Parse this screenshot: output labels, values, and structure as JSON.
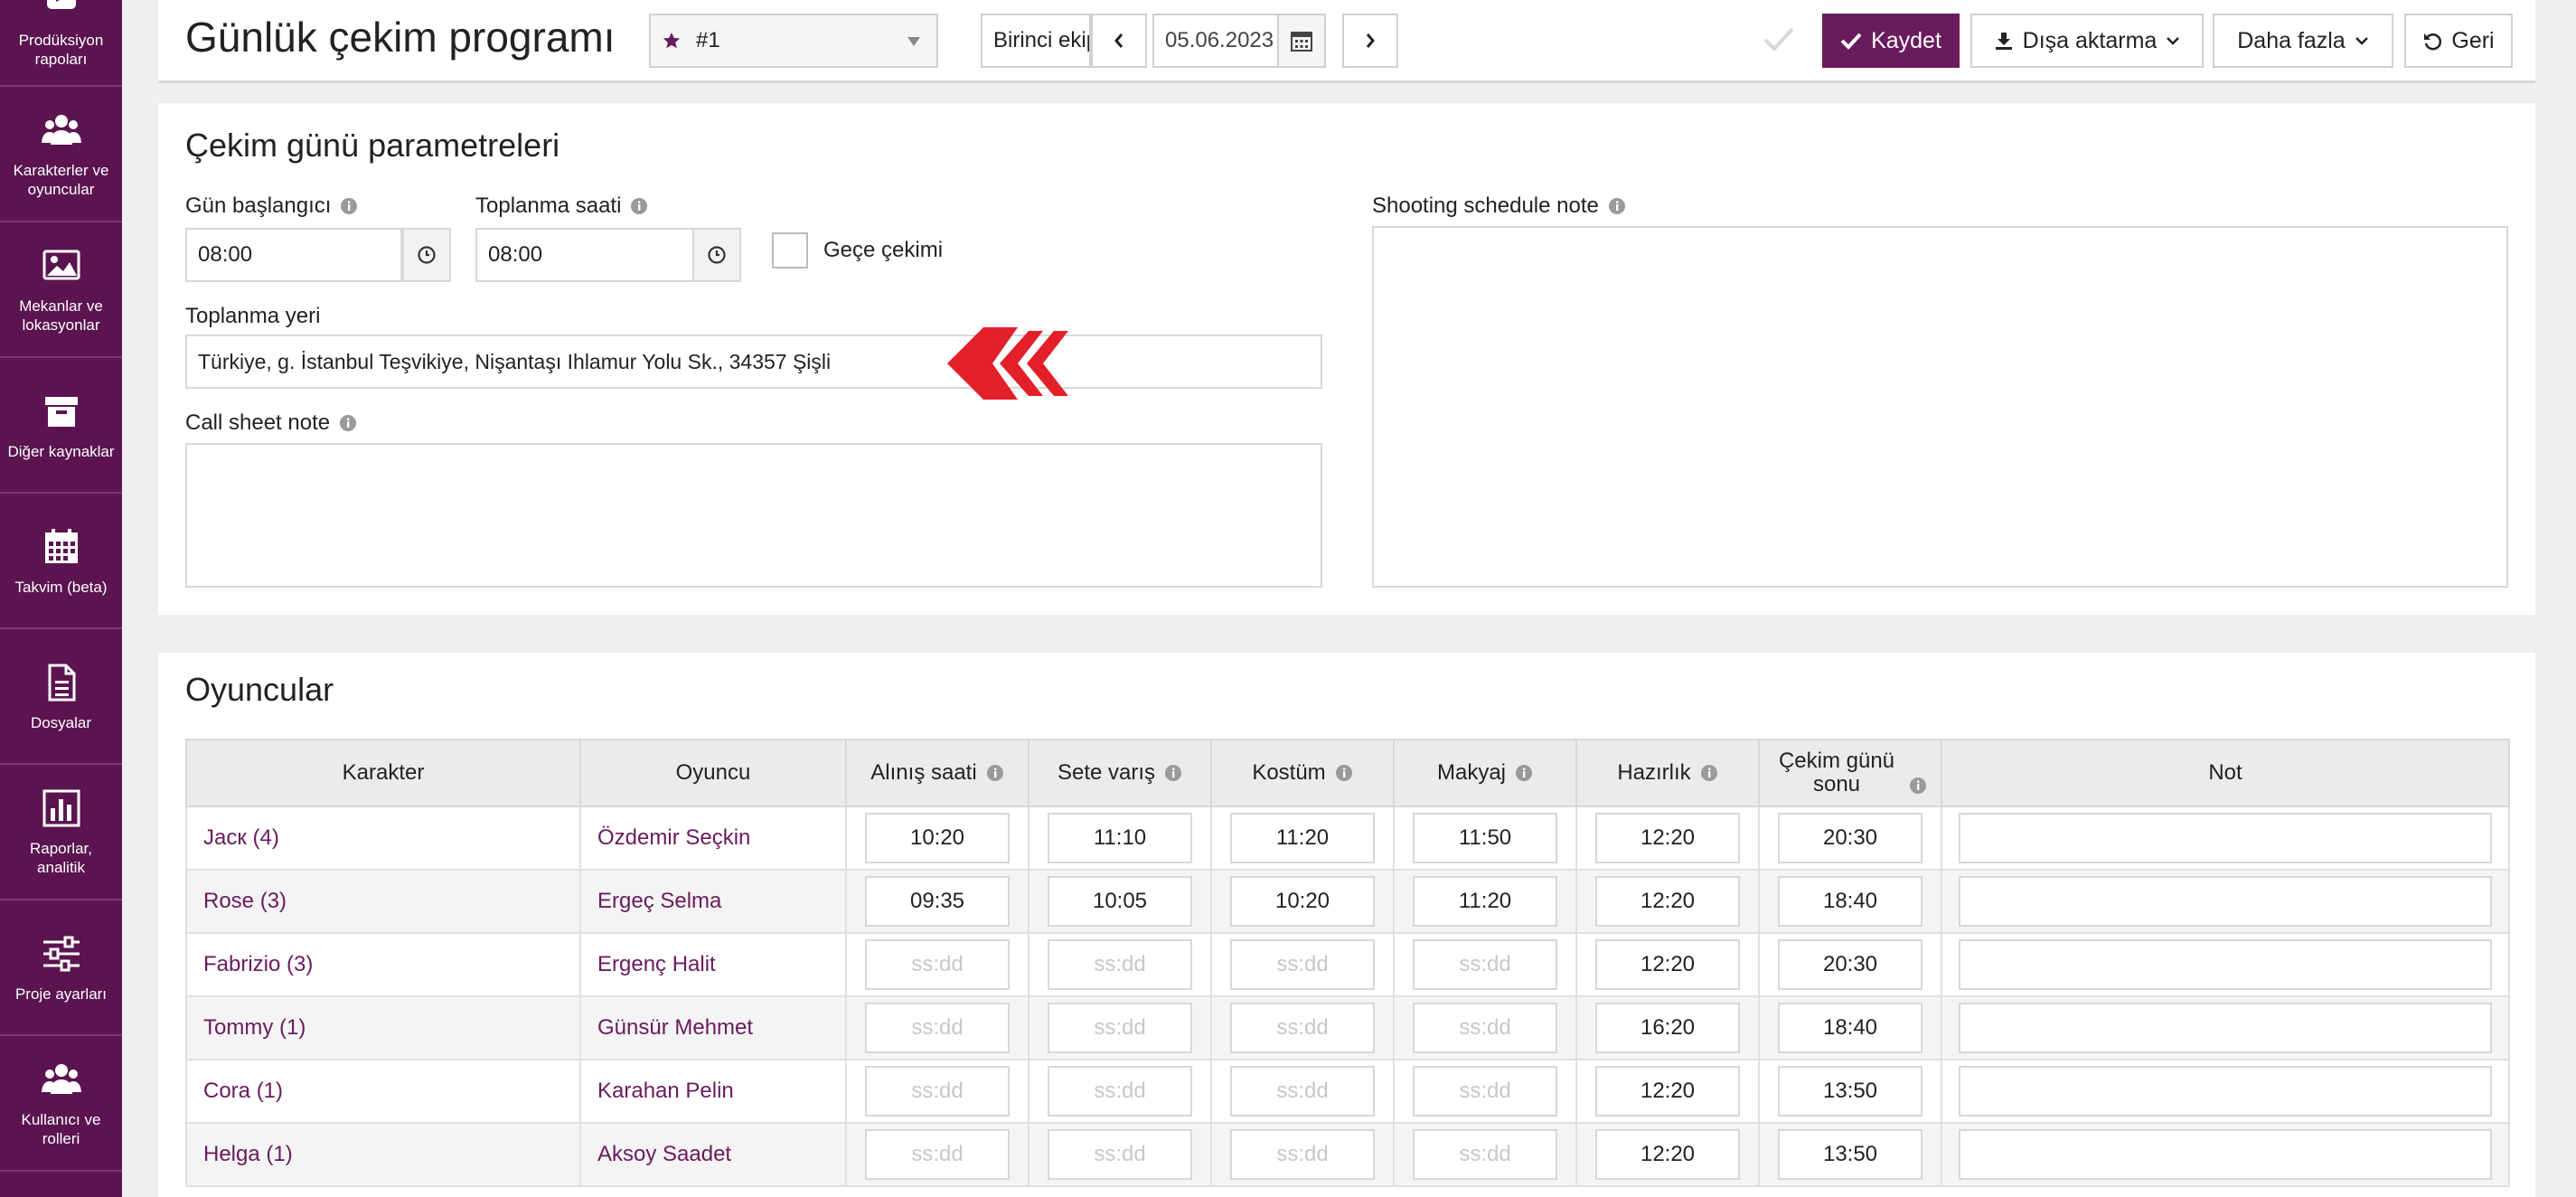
{
  "sidebar": {
    "items": [
      {
        "label": "Prodüksiyon rapoları",
        "icon": "report-icon"
      },
      {
        "label": "Karakterler ve oyuncular",
        "icon": "people-icon"
      },
      {
        "label": "Mekanlar ve lokasyonlar",
        "icon": "image-icon"
      },
      {
        "label": "Diğer kaynaklar",
        "icon": "archive-icon"
      },
      {
        "label": "Takvim (beta)",
        "icon": "calendar-icon"
      },
      {
        "label": "Dosyalar",
        "icon": "document-icon"
      },
      {
        "label": "Raporlar, analitik",
        "icon": "bar-chart-icon"
      },
      {
        "label": "Proje ayarları",
        "icon": "sliders-icon"
      },
      {
        "label": "Kullanıcı ve rolleri",
        "icon": "users-icon"
      }
    ],
    "bg_color": "#5b1450"
  },
  "header": {
    "title": "Günlük çekim programı",
    "schedule_select": "#1",
    "team_input": "Birinci ekip",
    "date": "05.06.2023",
    "save_label": "Kaydet",
    "export_label": "Dışa aktarma",
    "more_label": "Daha fazla",
    "back_label": "Geri",
    "accent_color": "#6a1b5e"
  },
  "params": {
    "title": "Çekim günü parametreleri",
    "day_start_label": "Gün başlangıcı",
    "day_start_value": "08:00",
    "gathering_time_label": "Toplanma saati",
    "gathering_time_value": "08:00",
    "night_shoot_label": "Geçe çekimi",
    "night_shoot_checked": false,
    "gathering_place_label": "Toplanma yeri",
    "gathering_place_value": "Türkiye, g. İstanbul Teşvikiye, Nişantaşı Ihlamur Yolu Sk., 34357 Şişli",
    "call_sheet_note_label": "Call sheet note",
    "shooting_note_label": "Shooting schedule note"
  },
  "cast": {
    "title": "Oyuncular",
    "columns": {
      "character": "Karakter",
      "actor": "Oyuncu",
      "pickup": "Alınış saati",
      "arrival": "Sete varış",
      "costume": "Kostüm",
      "makeup": "Makyaj",
      "ready": "Hazırlık",
      "wrap": "Çekim günü sonu",
      "note": "Not"
    },
    "placeholder": "ss:dd",
    "rows": [
      {
        "character": "Jacк (4)",
        "actor": "Özdemir Seçkin",
        "pickup": "10:20",
        "arrival": "11:10",
        "costume": "11:20",
        "makeup": "11:50",
        "ready": "12:20",
        "wrap": "20:30"
      },
      {
        "character": "Rose (3)",
        "actor": "Ergeç Selma",
        "pickup": "09:35",
        "arrival": "10:05",
        "costume": "10:20",
        "makeup": "11:20",
        "ready": "12:20",
        "wrap": "18:40"
      },
      {
        "character": "Fabrizio (3)",
        "actor": "Ergenç Halit",
        "pickup": "",
        "arrival": "",
        "costume": "",
        "makeup": "",
        "ready": "12:20",
        "wrap": "20:30"
      },
      {
        "character": "Tommy (1)",
        "actor": "Günsür Mehmet",
        "pickup": "",
        "arrival": "",
        "costume": "",
        "makeup": "",
        "ready": "16:20",
        "wrap": "18:40"
      },
      {
        "character": "Cora (1)",
        "actor": "Karahan Pelin",
        "pickup": "",
        "arrival": "",
        "costume": "",
        "makeup": "",
        "ready": "12:20",
        "wrap": "13:50"
      },
      {
        "character": "Helga (1)",
        "actor": "Aksoy Saadet",
        "pickup": "",
        "arrival": "",
        "costume": "",
        "makeup": "",
        "ready": "12:20",
        "wrap": "13:50"
      }
    ]
  }
}
